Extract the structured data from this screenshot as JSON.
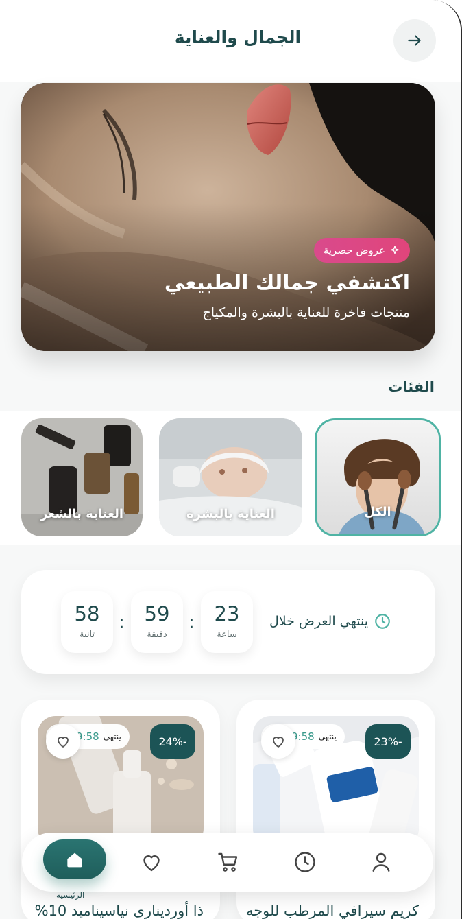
{
  "header": {
    "title": "الجمال والعناية",
    "back_icon": "arrow-right-icon"
  },
  "hero": {
    "badge": "عروض حصرية",
    "badge_icon": "sparkle-icon",
    "title": "اكتشفي جمالك الطبيعي",
    "subtitle": "منتجات فاخرة للعناية بالبشرة والمكياج"
  },
  "categories": {
    "title": "الفئات",
    "items": [
      {
        "label": "الكل",
        "active": true
      },
      {
        "label": "العناية بالبشرة",
        "active": false
      },
      {
        "label": "العناية بالشعر",
        "active": false
      }
    ]
  },
  "countdown": {
    "label": "ينتهي العرض خلال",
    "hours": "23",
    "hours_unit": "ساعة",
    "minutes": "59",
    "minutes_unit": "دقيقة",
    "seconds": "58",
    "seconds_unit": "ثانية",
    "separator": ":"
  },
  "products": [
    {
      "name": "كريم سيرافي المرطب للوجه",
      "discount": "23%-",
      "timer_label": "ينتهي",
      "timer_value": "9:58"
    },
    {
      "name": "ذا أوردينارى نياسيناميد 10%",
      "discount": "24%-",
      "timer_label": "ينتهي",
      "timer_value": "9:58"
    }
  ],
  "nav": {
    "home_label": "الرئيسية",
    "items": [
      "home-icon",
      "heart-icon",
      "cart-icon",
      "clock-icon",
      "user-icon"
    ]
  },
  "colors": {
    "primary": "#1f5e5b",
    "accent": "#4fb3a4",
    "badge": "#e0457b",
    "text": "#1f4a4c"
  }
}
